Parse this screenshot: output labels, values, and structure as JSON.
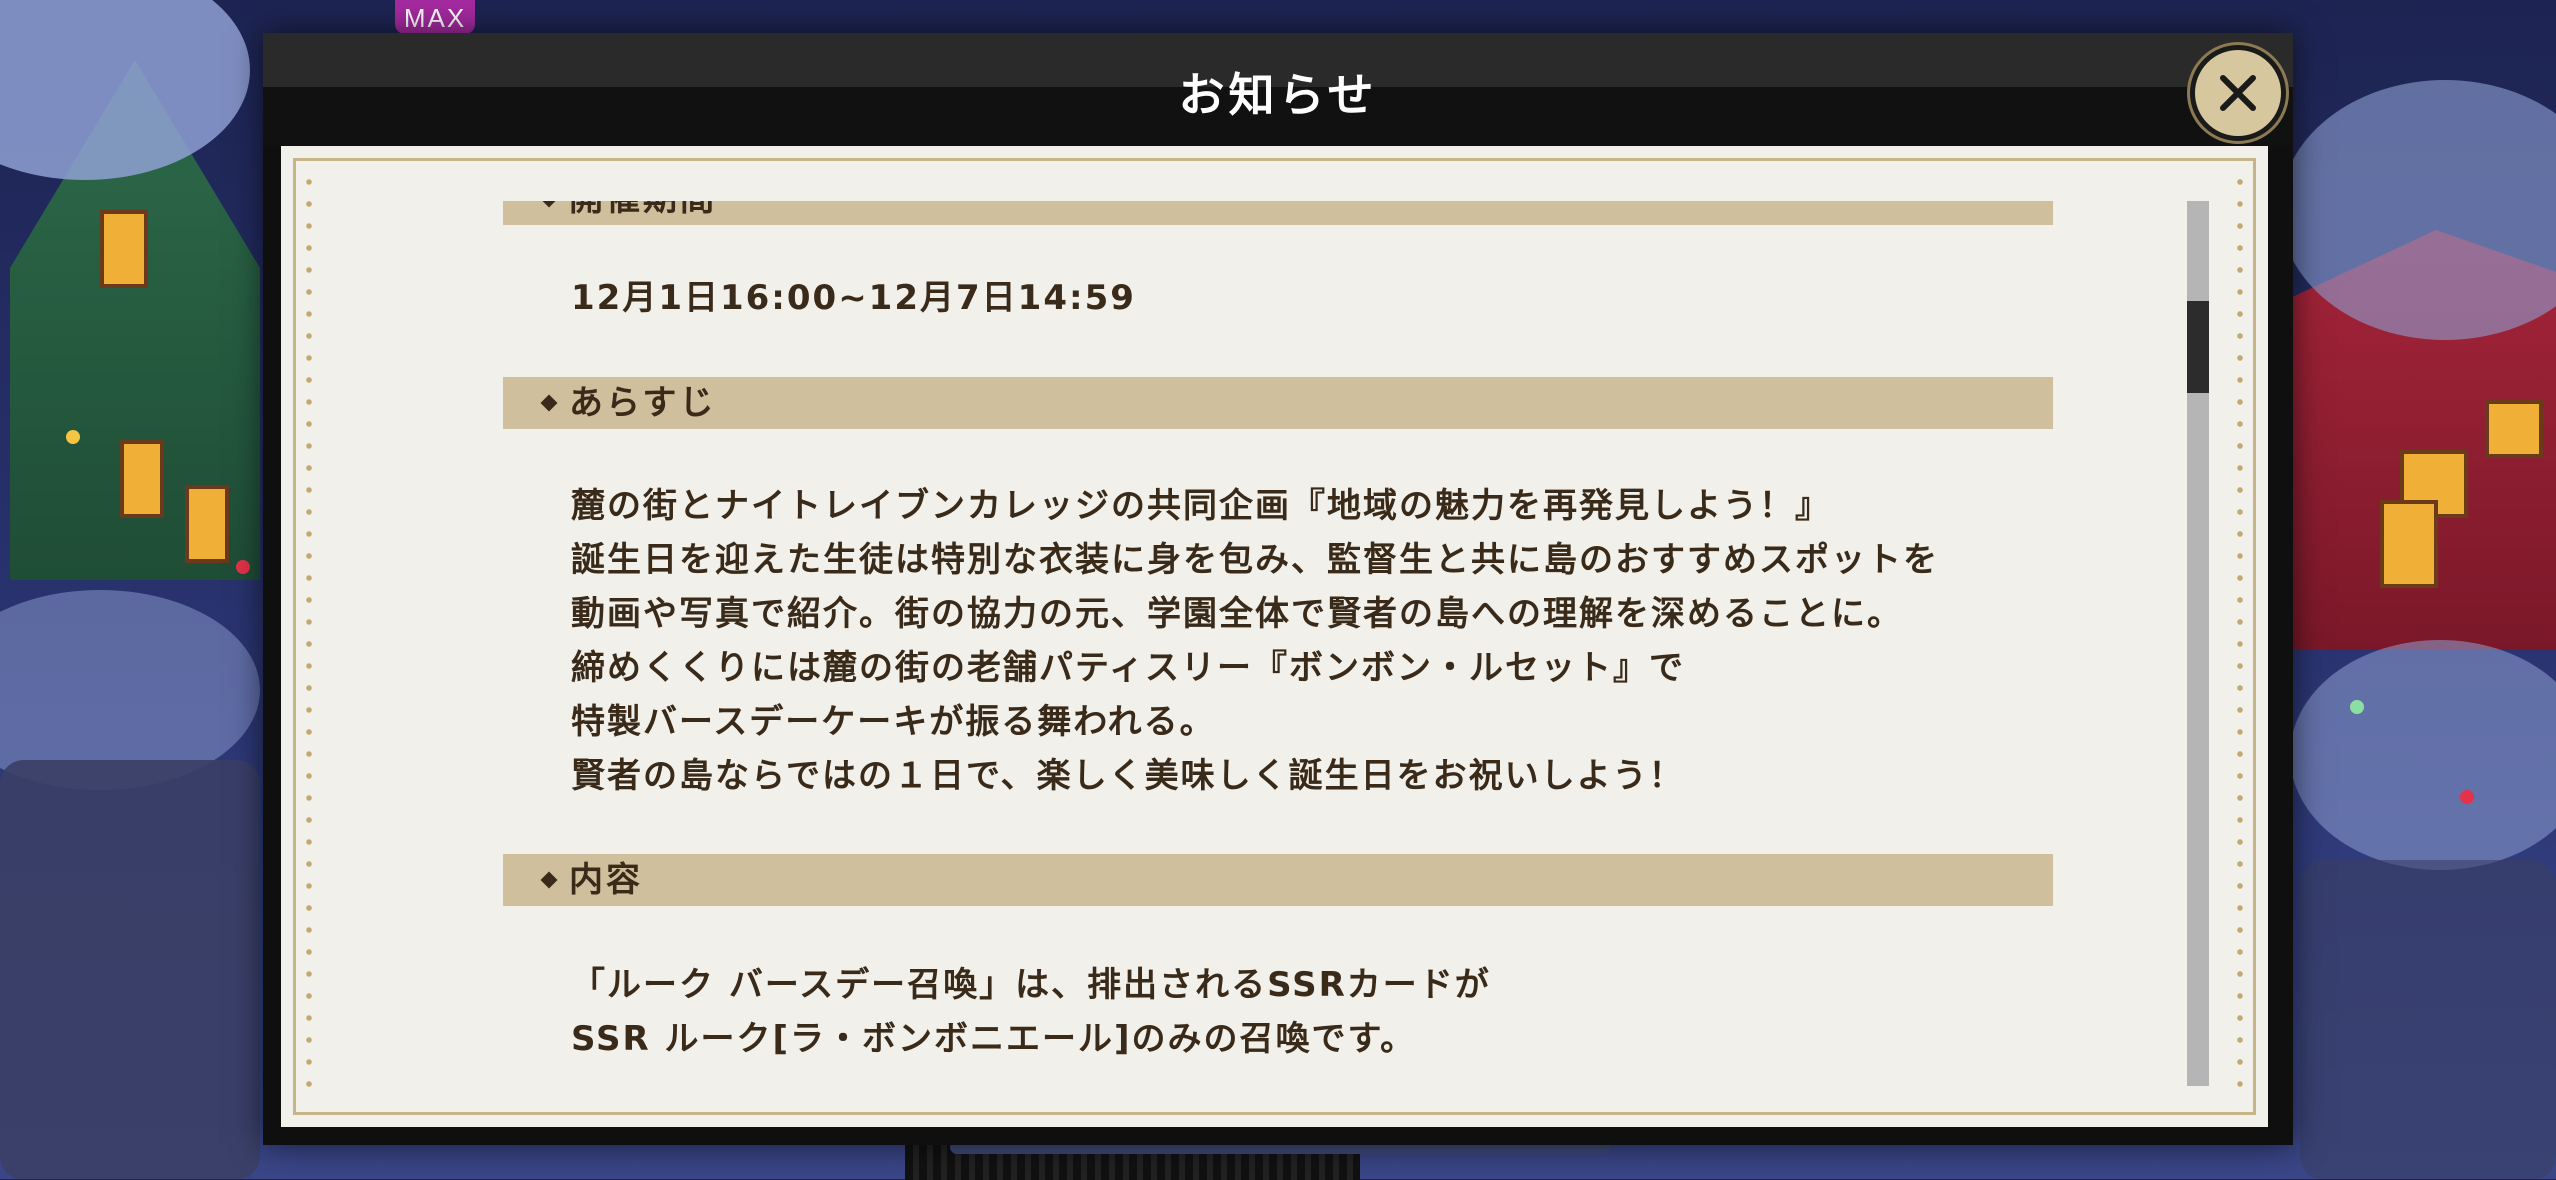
{
  "badge": {
    "label": "MAX"
  },
  "modal": {
    "title": "お知らせ",
    "close_icon": "close-icon"
  },
  "sections": {
    "period": {
      "heading": "開催期間",
      "lines": [
        "12月1日16:00~12月7日14:59"
      ]
    },
    "synopsis": {
      "heading": "あらすじ",
      "lines": [
        "麓の街とナイトレイブンカレッジの共同企画『地域の魅力を再発見しよう！』",
        "誕生日を迎えた生徒は特別な衣装に身を包み、監督生と共に島のおすすめスポットを",
        "動画や写真で紹介。街の協力の元、学園全体で賢者の島への理解を深めることに。",
        "締めくくりには麓の街の老舗パティスリー『ボンボン・ルセット』で",
        "特製バースデーケーキが振る舞われる。",
        "賢者の島ならではの１日で、楽しく美味しく誕生日をお祝いしよう！"
      ]
    },
    "content": {
      "heading": "内容",
      "lines": [
        "「ルーク バースデー召喚」は、排出されるSSRカードが",
        "SSR ルーク[ラ・ボンボニエール]のみの召喚です。"
      ]
    }
  },
  "colors": {
    "section_bg": "#cfbf9c",
    "text": "#3a2a1a",
    "paper": "#f2f0ea",
    "accent_gold": "#c7b487"
  }
}
